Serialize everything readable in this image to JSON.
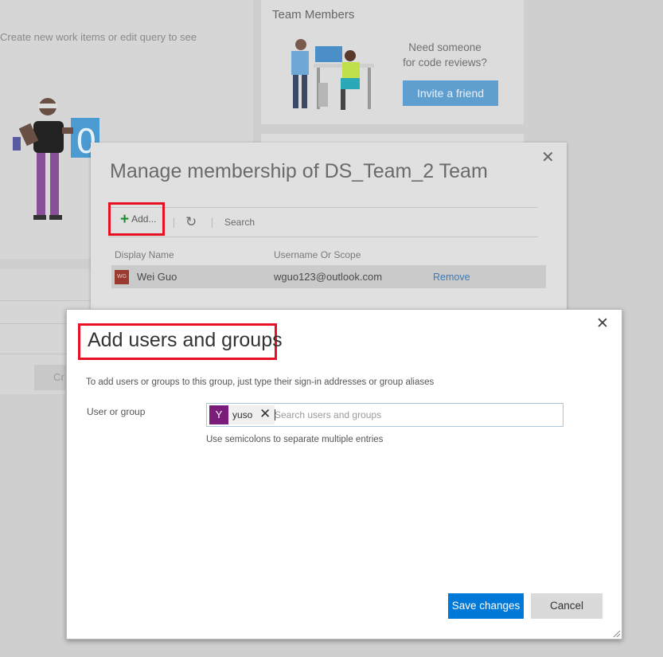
{
  "background": {
    "left_text": "Create new work items or edit query to see",
    "left_button_fragment": "Cr",
    "team_card": {
      "title": "Team Members",
      "prompt": "Need someone for code reviews?",
      "invite_label": "Invite a friend",
      "invite_color": "#5f9fcf"
    }
  },
  "manage_dialog": {
    "title": "Manage membership of DS_Team_2 Team",
    "toolbar": {
      "add_label": "Add...",
      "refresh_icon": "refresh-icon",
      "search_label": "Search"
    },
    "columns": [
      "Display Name",
      "Username Or Scope"
    ],
    "members": [
      {
        "initials": "WG",
        "display_name": "Wei Guo",
        "username": "wguo123@outlook.com",
        "action": "Remove"
      }
    ]
  },
  "add_dialog": {
    "title": "Add users and groups",
    "description": "To add users or groups to this group, just type their sign-in addresses or group aliases",
    "field_label": "User or group",
    "selected": [
      {
        "initial": "Y",
        "name": "yuso",
        "color": "#7a1d7a"
      }
    ],
    "search_placeholder": "Search users and groups",
    "hint": "Use semicolons to separate multiple entries",
    "save_label": "Save changes",
    "cancel_label": "Cancel",
    "accent_color": "#0078d7",
    "highlight_color": "#e81123"
  }
}
